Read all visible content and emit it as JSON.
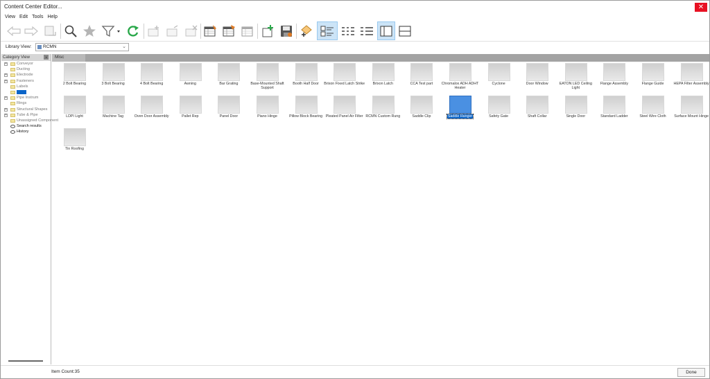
{
  "window": {
    "title": "Content Center Editor..."
  },
  "menu": {
    "items": [
      "View",
      "Edit",
      "Tools",
      "Help"
    ]
  },
  "library": {
    "label": "Library View:",
    "value": "RCMN"
  },
  "category_panel": {
    "title": "Category View",
    "tree": [
      {
        "label": "Conveyor",
        "expander": "+",
        "state": "dim"
      },
      {
        "label": "Ducting",
        "expander": "",
        "state": "dim"
      },
      {
        "label": "Electrode",
        "expander": "+",
        "state": "dim"
      },
      {
        "label": "Fasteners",
        "expander": "+",
        "state": "dim"
      },
      {
        "label": "Labels",
        "expander": "",
        "state": "dim"
      },
      {
        "label": "",
        "expander": "",
        "state": "selected"
      },
      {
        "label": "Pipe Instrum",
        "expander": "+",
        "state": "dim"
      },
      {
        "label": "Rings",
        "expander": "",
        "state": "dim"
      },
      {
        "label": "Structural Shapes",
        "expander": "+",
        "state": "dim"
      },
      {
        "label": "Tube & Pipe",
        "expander": "+",
        "state": "dim"
      },
      {
        "label": "Unassigned Component",
        "expander": "",
        "state": "dim"
      },
      {
        "label": "Search results",
        "expander": "",
        "state": "dark"
      },
      {
        "label": "History",
        "expander": "",
        "state": "dark"
      }
    ]
  },
  "content": {
    "header": "Misc",
    "items": [
      {
        "name": "2 Bolt Bearing"
      },
      {
        "name": "3 Bolt Bearing"
      },
      {
        "name": "4 Bolt Bearing"
      },
      {
        "name": "Awning"
      },
      {
        "name": "Bar Grating"
      },
      {
        "name": "Base-Mounted Shaft Support"
      },
      {
        "name": "Booth Half Door"
      },
      {
        "name": "Brixon Fixed Latch Strike"
      },
      {
        "name": "Brixon Latch"
      },
      {
        "name": "CCA Test part"
      },
      {
        "name": "Chromalox ADH ADHT Heater"
      },
      {
        "name": "Cyclone"
      },
      {
        "name": "Door Window"
      },
      {
        "name": "EATON LED Ceiling Light"
      },
      {
        "name": "Flange Assembly"
      },
      {
        "name": "Flange Guide"
      },
      {
        "name": "HEPA Filter Assembly"
      },
      {
        "name": "LDPI Light"
      },
      {
        "name": "Machine Tag"
      },
      {
        "name": "Oven Door Assembly"
      },
      {
        "name": "Pallet Rep"
      },
      {
        "name": "Panel Door"
      },
      {
        "name": "Piano Hinge"
      },
      {
        "name": "Pillow Block Bearing"
      },
      {
        "name": "Pleated Panel Air Filter"
      },
      {
        "name": "RCMN Custom Rung"
      },
      {
        "name": "Saddle Clip"
      },
      {
        "name": "Saddle Hanger",
        "selected": true
      },
      {
        "name": "Safety Gate"
      },
      {
        "name": "Shaft Collar"
      },
      {
        "name": "Single Door"
      },
      {
        "name": "Standard Ladder"
      },
      {
        "name": "Steel Wire Cloth"
      },
      {
        "name": "Surface Mount Hinge"
      },
      {
        "name": "Tin Roofing"
      }
    ]
  },
  "status": {
    "item_count": "Item Count:35",
    "done_label": "Done"
  },
  "toolbar": {
    "buttons": [
      {
        "icon": "back-arrow-icon"
      },
      {
        "icon": "forward-arrow-icon"
      },
      {
        "icon": "home-folder-icon"
      },
      {
        "icon": "search-icon"
      },
      {
        "icon": "favorite-star-icon"
      },
      {
        "icon": "filter-icon"
      },
      {
        "icon": "refresh-icon"
      },
      {
        "icon": "new-family-icon"
      },
      {
        "icon": "copy-family-icon"
      },
      {
        "icon": "delete-family-icon"
      },
      {
        "icon": "family-table-icon"
      },
      {
        "icon": "edit-table-icon"
      },
      {
        "icon": "table-properties-icon"
      },
      {
        "icon": "publish-icon"
      },
      {
        "icon": "save-icon"
      },
      {
        "icon": "author-icon"
      },
      {
        "icon": "thumbnail-view-icon",
        "active": true
      },
      {
        "icon": "list-view-icon"
      },
      {
        "icon": "detail-view-icon"
      },
      {
        "icon": "tree-pane-icon",
        "active": true
      },
      {
        "icon": "table-pane-icon"
      }
    ]
  },
  "colors": {
    "accent": "#0a64c8",
    "refresh": "#2aa84a",
    "close": "#e81123",
    "header_bar": "#a3a3a3"
  }
}
